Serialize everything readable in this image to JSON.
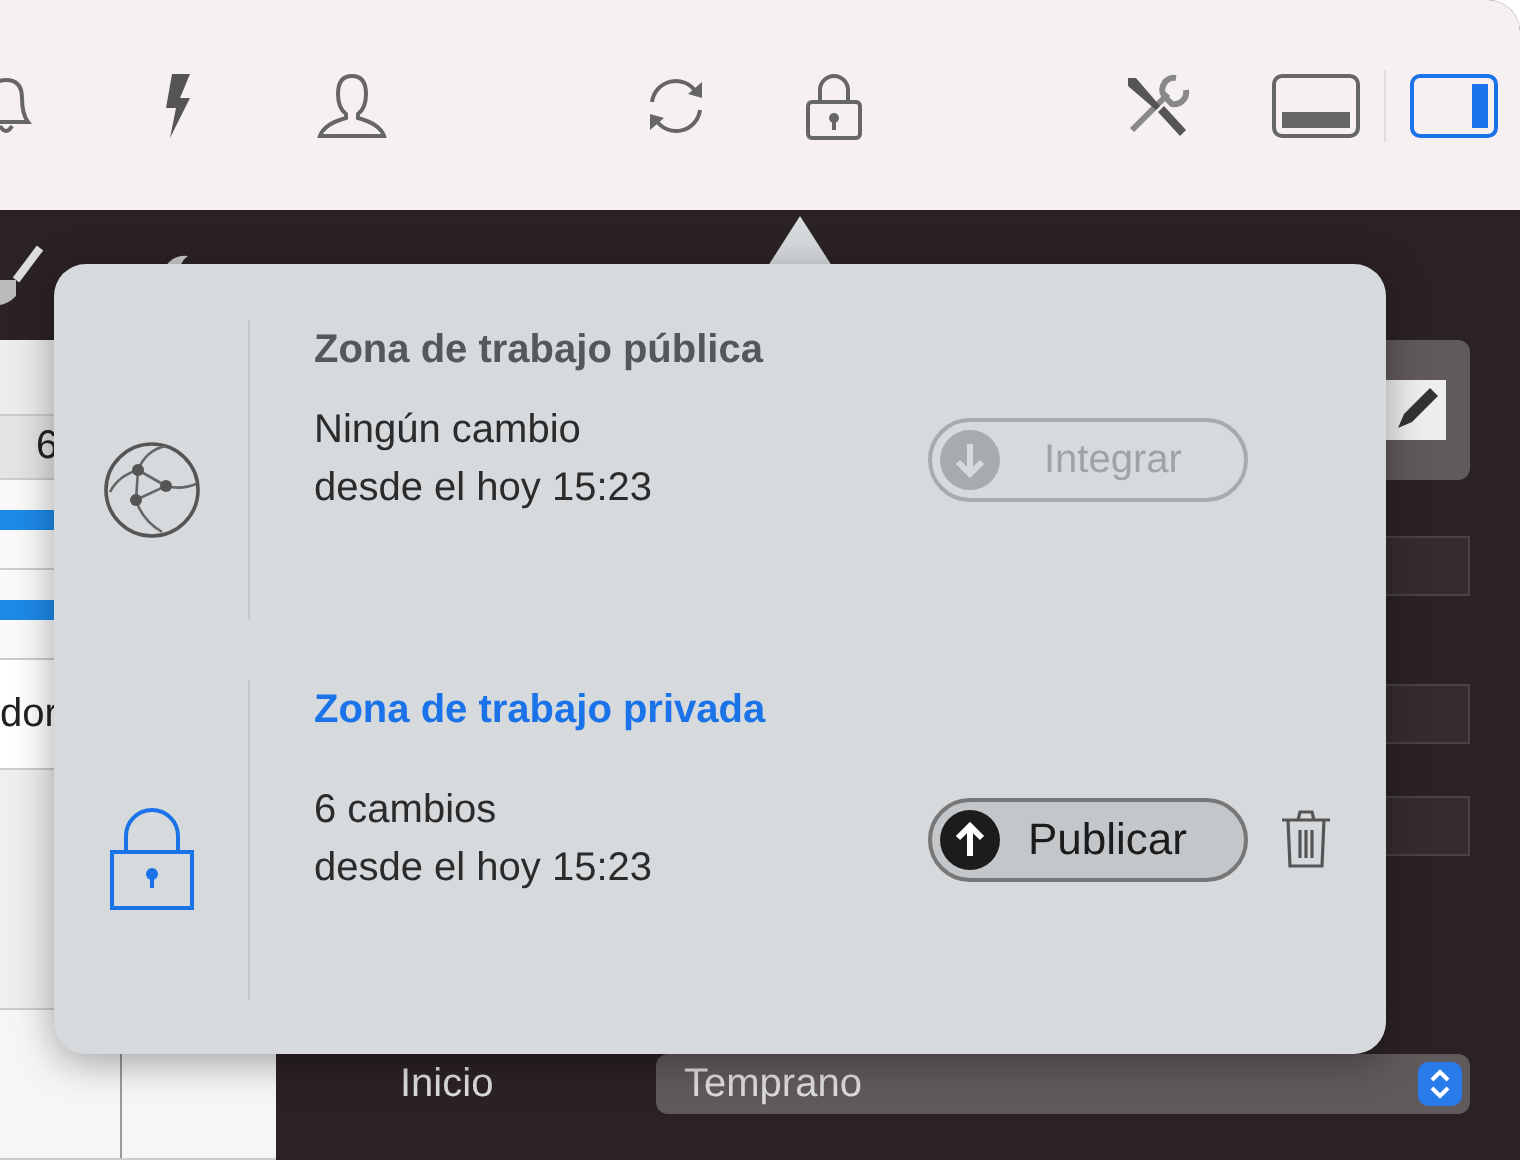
{
  "toolbar": {
    "panel_toggles": [
      {
        "kind": "bottom",
        "selected": false
      },
      {
        "kind": "right",
        "selected": true
      }
    ]
  },
  "list_cells": [
    "6",
    "dor"
  ],
  "form": {
    "label": "Inicio",
    "dropdown": {
      "value": "Temprano"
    }
  },
  "popover": {
    "sections": [
      {
        "kind": "public",
        "title": "Zona de trabajo pública",
        "status": "Ningún cambio",
        "since": "desde el hoy 15:23",
        "action": {
          "kind": "download",
          "label": "Integrar",
          "disabled": true
        },
        "delete": false
      },
      {
        "kind": "private",
        "title": "Zona de trabajo privada",
        "status": "6 cambios",
        "since": "desde el hoy 15:23",
        "action": {
          "kind": "upload",
          "label": "Publicar",
          "disabled": false
        },
        "delete": true
      }
    ]
  }
}
